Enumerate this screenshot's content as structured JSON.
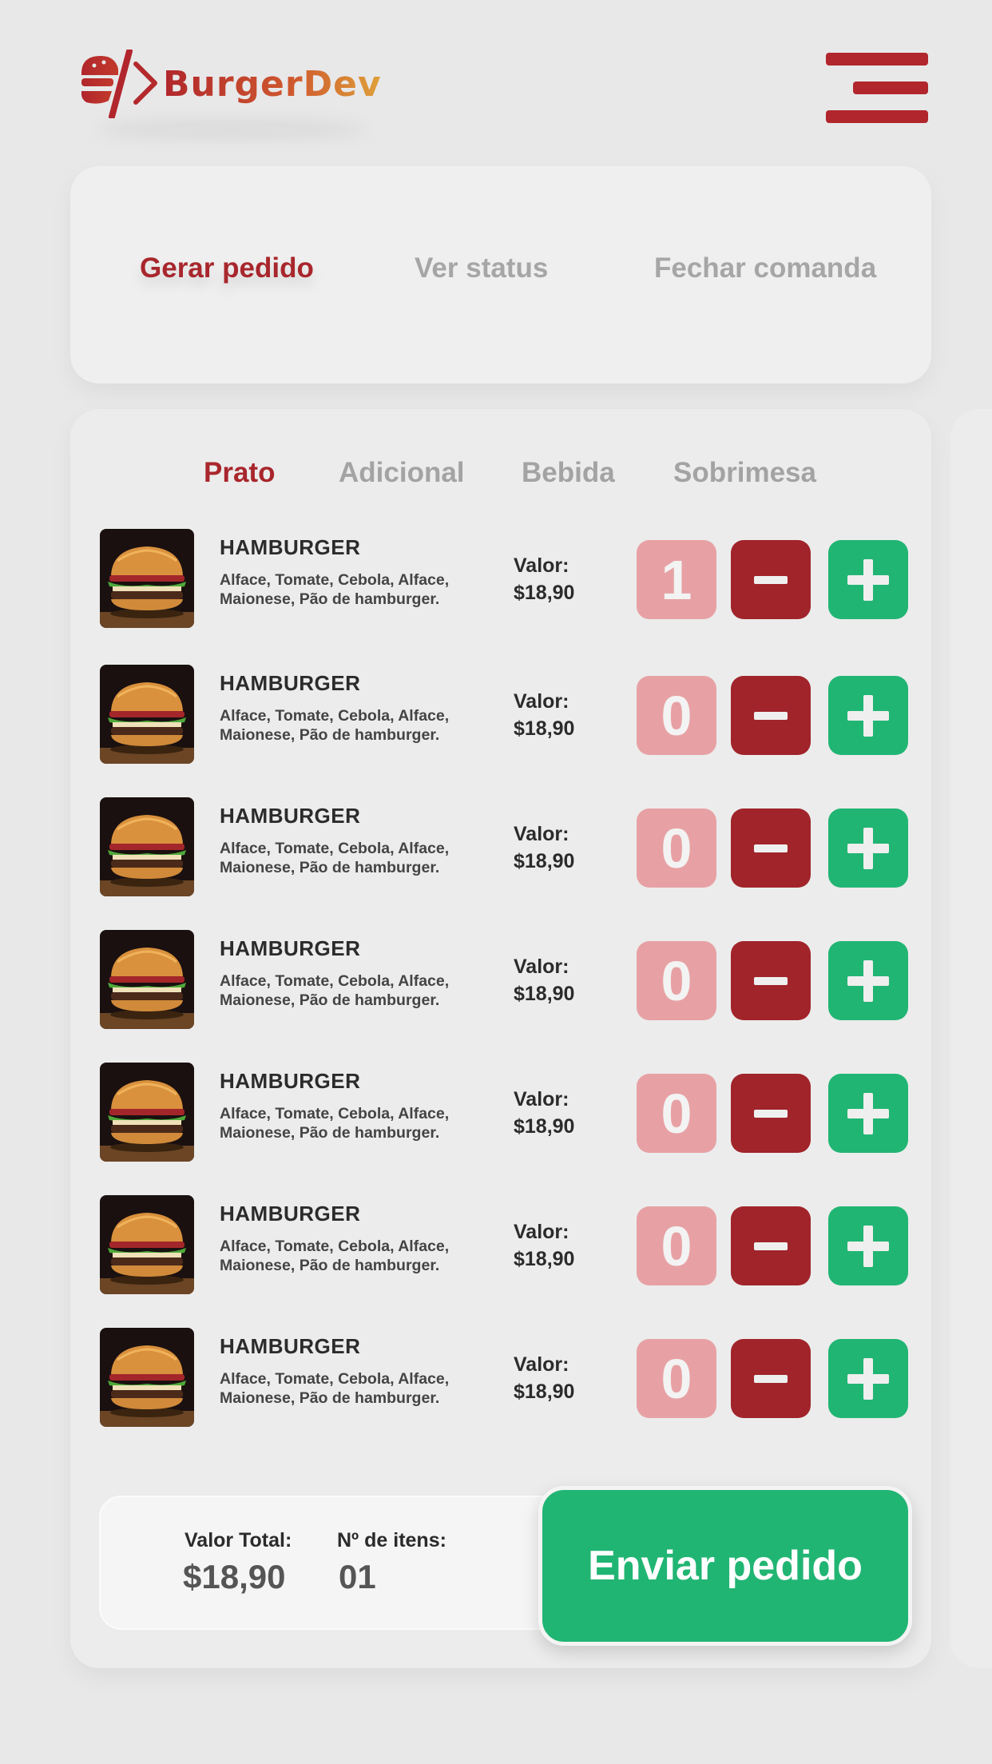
{
  "brand": {
    "name": "BurgerDev",
    "primary": "#b1262c",
    "gradient_end": "#dfa13a"
  },
  "header": {
    "menu_icon": "hamburger-menu-icon"
  },
  "nav": {
    "items": [
      {
        "label": "Gerar pedido",
        "active": true
      },
      {
        "label": "Ver status",
        "active": false
      },
      {
        "label": "Fechar comanda",
        "active": false
      }
    ]
  },
  "categories": [
    {
      "label": "Prato",
      "active": true
    },
    {
      "label": "Adicional",
      "active": false
    },
    {
      "label": "Bebida",
      "active": false
    },
    {
      "label": "Sobrimesa",
      "active": false
    }
  ],
  "items": [
    {
      "name": "HAMBURGER",
      "desc": "Alface, Tomate, Cebola, Alface, Maionese, Pão de hamburger.",
      "price_label": "Valor:",
      "price": "$18,90",
      "qty": "1"
    },
    {
      "name": "HAMBURGER",
      "desc": "Alface, Tomate, Cebola, Alface, Maionese, Pão de hamburger.",
      "price_label": "Valor:",
      "price": "$18,90",
      "qty": "0"
    },
    {
      "name": "HAMBURGER",
      "desc": "Alface, Tomate, Cebola, Alface, Maionese, Pão de hamburger.",
      "price_label": "Valor:",
      "price": "$18,90",
      "qty": "0"
    },
    {
      "name": "HAMBURGER",
      "desc": "Alface, Tomate, Cebola, Alface, Maionese, Pão de hamburger.",
      "price_label": "Valor:",
      "price": "$18,90",
      "qty": "0"
    },
    {
      "name": "HAMBURGER",
      "desc": "Alface, Tomate, Cebola, Alface, Maionese, Pão de hamburger.",
      "price_label": "Valor:",
      "price": "$18,90",
      "qty": "0"
    },
    {
      "name": "HAMBURGER",
      "desc": "Alface, Tomate, Cebola, Alface, Maionese, Pão de hamburger.",
      "price_label": "Valor:",
      "price": "$18,90",
      "qty": "0"
    },
    {
      "name": "HAMBURGER",
      "desc": "Alface, Tomate, Cebola, Alface, Maionese, Pão de hamburger.",
      "price_label": "Valor:",
      "price": "$18,90",
      "qty": "0"
    }
  ],
  "colors": {
    "minus": "#a0242a",
    "plus": "#21b573",
    "qty_bg": "#e7a1a4"
  },
  "summary": {
    "total_label": "Valor Total:",
    "total_value": "$18,90",
    "count_label": "Nº de itens:",
    "count_value": "01"
  },
  "actions": {
    "send_label": "Enviar pedido"
  }
}
